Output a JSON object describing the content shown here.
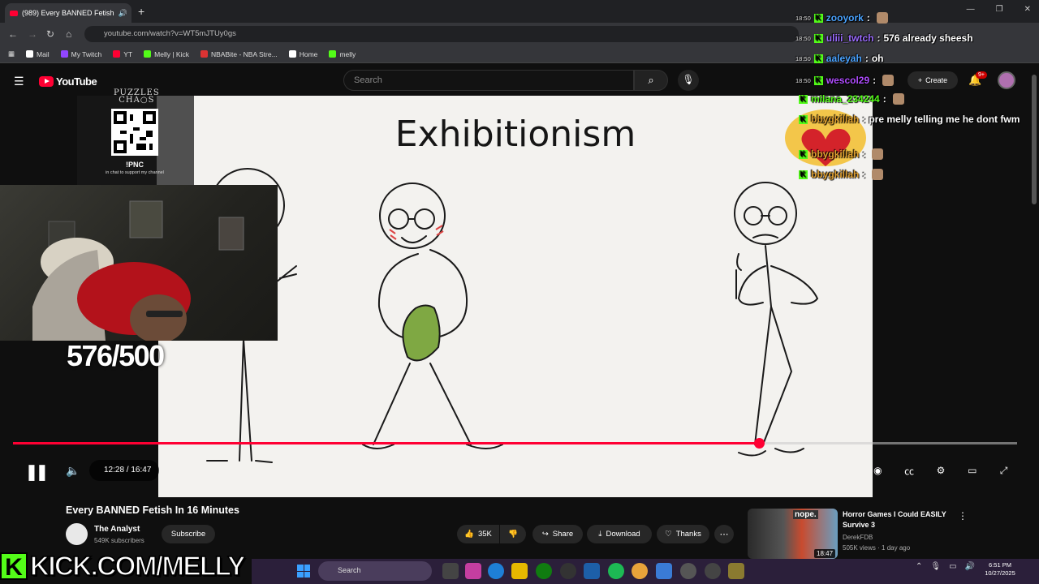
{
  "browser": {
    "tab_title": "(989) Every BANNED Fetish",
    "new_tab": "+",
    "url": "youtube.com/watch?v=WT5mJTUy0gs",
    "bookmarks": [
      {
        "label": "Mail",
        "color": "#ffffff"
      },
      {
        "label": "My Twitch",
        "color": "#9146ff"
      },
      {
        "label": "YT",
        "color": "#ff0033"
      },
      {
        "label": "Melly | Kick",
        "color": "#53fc18"
      },
      {
        "label": "NBABite - NBA Stre...",
        "color": "#d33"
      },
      {
        "label": "Home",
        "color": "#ffffff"
      },
      {
        "label": "melly",
        "color": "#53fc18"
      }
    ]
  },
  "youtube": {
    "logo": "YouTube",
    "search_placeholder": "Search",
    "create_label": "Create",
    "notif_badge": "9+"
  },
  "video": {
    "slide_title": "Exhibitionism",
    "current_time": "12:28",
    "duration": "16:47",
    "time_display": "12:28 / 16:47",
    "progress": 0.743,
    "title": "Every BANNED Fetish In 16 Minutes",
    "channel": "The Analyst",
    "subscribers": "549K subscribers",
    "subscribe_label": "Subscribe",
    "likes": "35K",
    "share_label": "Share",
    "download_label": "Download",
    "thanks_label": "Thanks"
  },
  "overlay": {
    "puzzles": "PUZZLES\nCHAOS",
    "pnc": "!PNC",
    "pnc_sub": "in chat to support my channel",
    "counter": "576/500",
    "kick_text": "KICK.COM/MELLY"
  },
  "recommendation": {
    "title": "Horror Games I Could EASILY Survive 3",
    "channel": "DerekFDB",
    "meta": "505K views · 1 day ago",
    "duration": "18:47",
    "thumb_text": "nope."
  },
  "chat": [
    {
      "time": "18:50",
      "user": "zooyork",
      "color": "#4aa3ff",
      "msg": ""
    },
    {
      "time": "18:50",
      "user": "uliii_twtch",
      "color": "#9b6bff",
      "msg": "576 already sheesh"
    },
    {
      "time": "18:50",
      "user": "aaleyah",
      "color": "#4aa3ff",
      "msg": "oh"
    },
    {
      "time": "18:50",
      "user": "wescol29",
      "color": "#b04cff",
      "msg": ""
    },
    {
      "time": "",
      "user": "milana_234244",
      "color": "#53fc18",
      "msg": ""
    },
    {
      "time": "",
      "user": "bbygkillah",
      "color": "#e0a030",
      "msg": "pre melly telling me he dont fwm"
    },
    {
      "time": "",
      "user": "bbygkillah",
      "color": "#e0a030",
      "msg": ""
    },
    {
      "time": "",
      "user": "bbygkillah",
      "color": "#e0a030",
      "msg": ""
    }
  ],
  "taskbar": {
    "search_placeholder": "Search",
    "time": "6:51 PM",
    "date": "10/27/2025"
  },
  "colors": {
    "progress": "#ff0033",
    "kick_green": "#53fc18"
  }
}
